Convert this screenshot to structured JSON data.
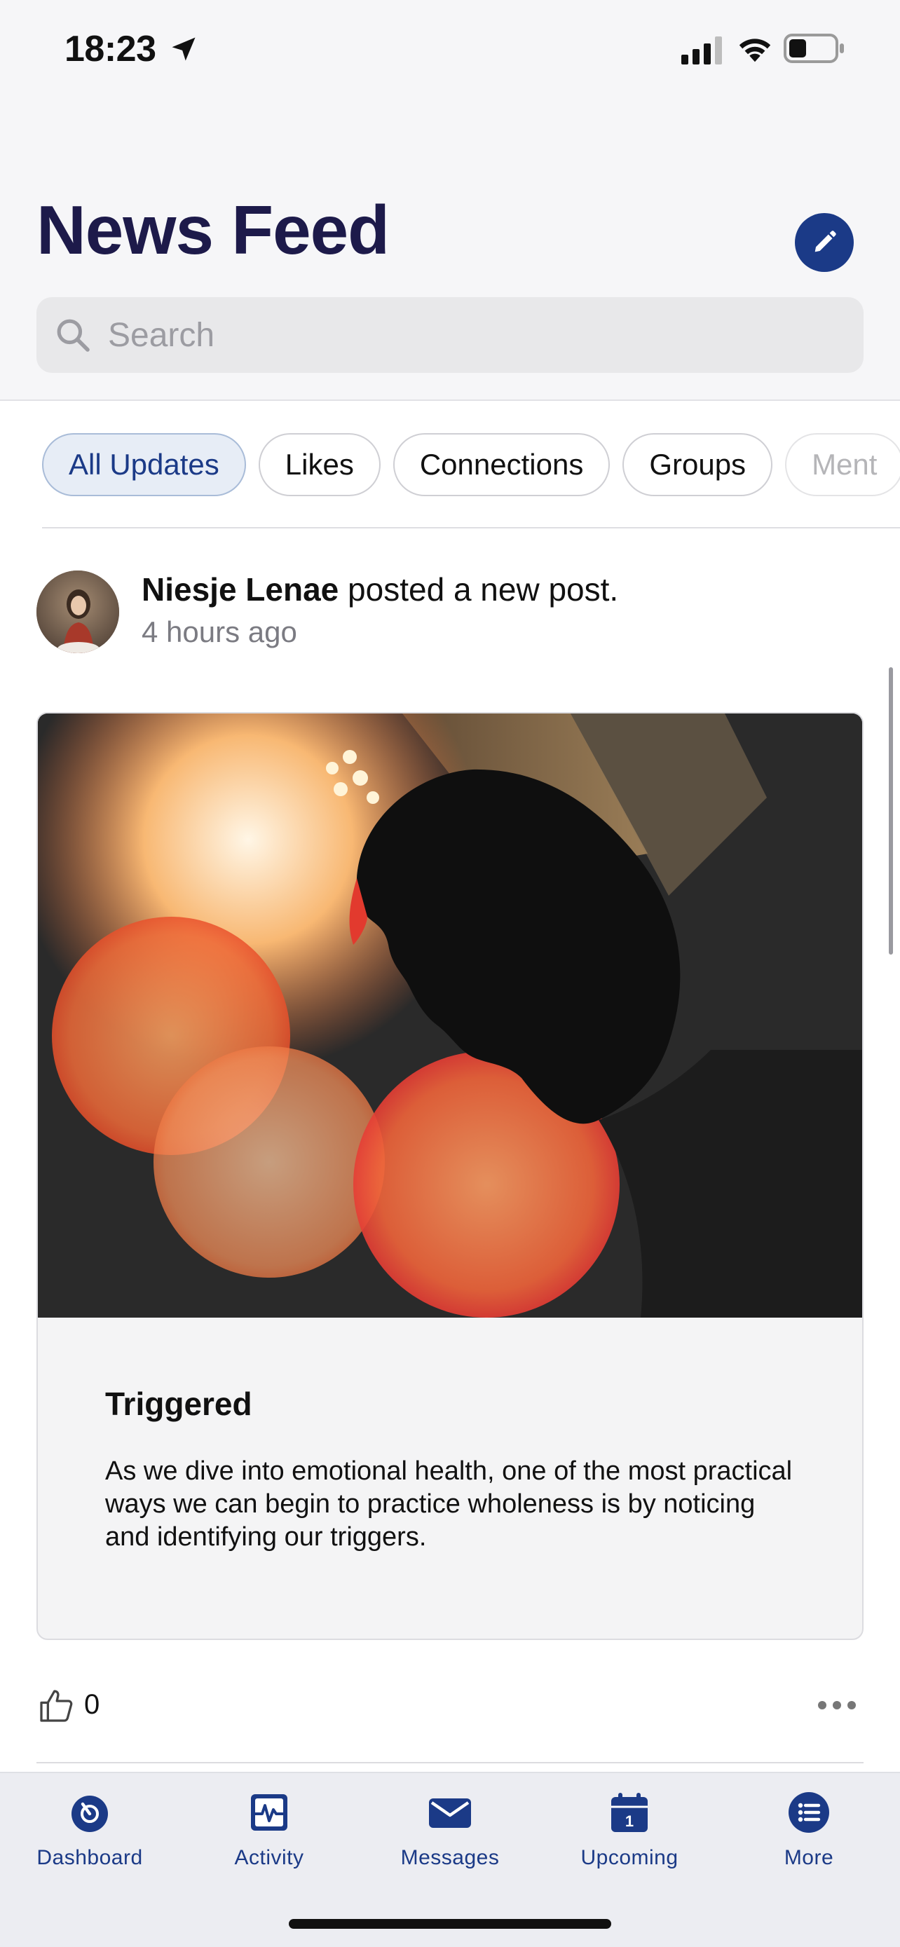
{
  "status_bar": {
    "time": "18:23"
  },
  "header": {
    "title": "News Feed",
    "search_placeholder": "Search"
  },
  "filters": [
    {
      "label": "All Updates",
      "active": true
    },
    {
      "label": "Likes",
      "active": false
    },
    {
      "label": "Connections",
      "active": false
    },
    {
      "label": "Groups",
      "active": false
    },
    {
      "label": "Ment",
      "active": false
    }
  ],
  "post": {
    "author": "Niesje Lenae",
    "action": "posted a new post.",
    "time": "4 hours ago",
    "card": {
      "title": "Triggered",
      "excerpt": "As we dive into emotional health, one of the most practical ways we can begin to practice wholeness is by noticing and identifying our triggers."
    },
    "like_count": "0"
  },
  "tabs": [
    {
      "label": "Dashboard",
      "icon": "dashboard-icon"
    },
    {
      "label": "Activity",
      "icon": "activity-icon"
    },
    {
      "label": "Messages",
      "icon": "messages-icon"
    },
    {
      "label": "Upcoming",
      "icon": "calendar-icon"
    },
    {
      "label": "More",
      "icon": "list-icon"
    }
  ],
  "colors": {
    "primary": "#1b3a87",
    "title": "#1d1a4a",
    "background": "#f6f6f8"
  }
}
